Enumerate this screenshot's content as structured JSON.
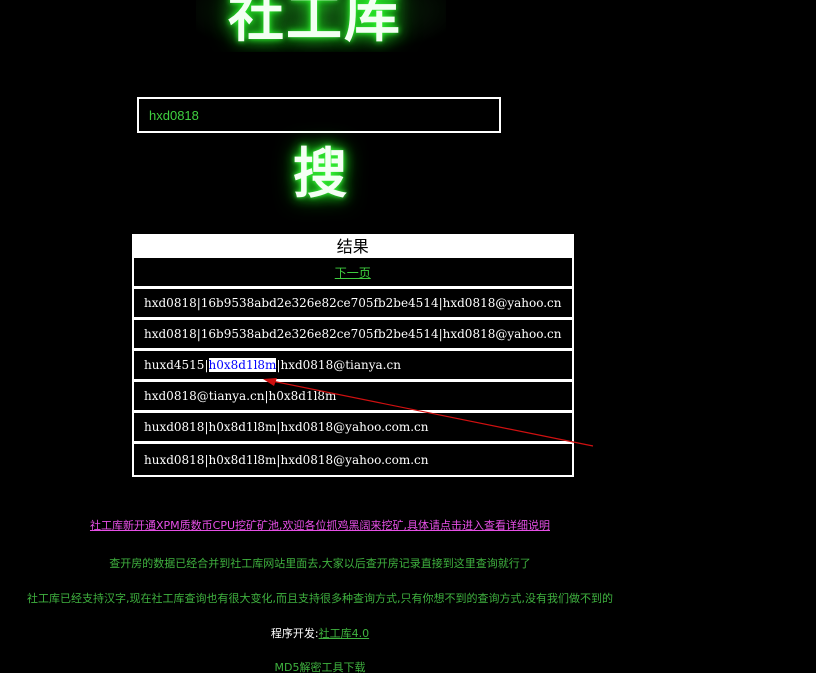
{
  "logo": {
    "text": "社工库"
  },
  "search": {
    "value": "hxd0818",
    "button_label": "搜"
  },
  "results": {
    "title": "结果",
    "next_page_label": "下一页",
    "rows": [
      {
        "text": "hxd0818|16b9538abd2e326e82ce705fb2be4514|hxd0818@yahoo.cn"
      },
      {
        "text": "hxd0818|16b9538abd2e326e82ce705fb2be4514|hxd0818@yahoo.cn"
      },
      {
        "before": "huxd4515|",
        "highlight": "h0x8d1l8m",
        "after": "|hxd0818@tianya.cn"
      },
      {
        "text": "hxd0818@tianya.cn|h0x8d1l8m"
      },
      {
        "text": "huxd0818|h0x8d1l8m|hxd0818@yahoo.com.cn"
      },
      {
        "text": "huxd0818|h0x8d1l8m|hxd0818@yahoo.com.cn"
      }
    ]
  },
  "annotation": {
    "arrow_color": "#d01010"
  },
  "footer": {
    "promo_link": "社工库新开通XPM质数币CPU挖矿矿池,欢迎各位抓鸡黑阔来挖矿,具体请点击进入查看详细说明",
    "notice1": "查开房的数据已经合并到社工库网站里面去,大家以后查开房记录直接到这里查询就行了",
    "notice2": "社工库已经支持汉字,现在社工库查询也有很大变化,而且支持很多种查询方式,只有你想不到的查询方式,没有我们做不到的",
    "dev_label": "程序开发:",
    "dev_link": "社工库4.0",
    "md5_link": "MD5解密工具下载"
  },
  "colors": {
    "background": "#000000",
    "green_text": "#3fb23f",
    "promo_pink": "#e64fe6",
    "highlight_text": "#0000ff"
  }
}
